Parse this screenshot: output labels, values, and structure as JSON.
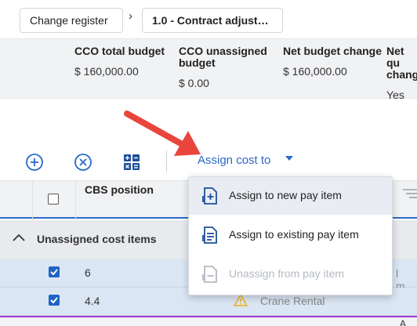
{
  "breadcrumb": {
    "parent": "Change register",
    "separator": "›",
    "current": "1.0 - Contract adjust…"
  },
  "summary": [
    {
      "label": "CCO total budget",
      "value": "$ 160,000.00"
    },
    {
      "label": "CCO unassigned budget",
      "value": "$ 0.00"
    },
    {
      "label": "Net budget change",
      "value": "$ 160,000.00"
    },
    {
      "label": "Net qu chang",
      "value": "Yes"
    }
  ],
  "toolbar": {
    "add_icon": "plus-circle-icon",
    "remove_icon": "x-circle-icon",
    "calc_icon": "calculator-icon",
    "assign_label": "Assign cost to"
  },
  "menu": {
    "items": [
      {
        "label": "Assign to new pay item",
        "icon": "add-pay-item-icon",
        "state": "highlighted"
      },
      {
        "label": "Assign to existing pay item",
        "icon": "existing-pay-item-icon",
        "state": "enabled"
      },
      {
        "label": "Unassign from pay item",
        "icon": "unassign-pay-item-icon",
        "state": "disabled"
      }
    ]
  },
  "table": {
    "header": {
      "cbs_position": "CBS position"
    },
    "group": {
      "label": "Unassigned cost items"
    },
    "rows": [
      {
        "checked": true,
        "cbs": "6",
        "description": "l m…"
      },
      {
        "checked": true,
        "cbs": "4.4",
        "description": "Crane Rental",
        "warning": true
      }
    ],
    "footer_truncated": "A"
  },
  "colors": {
    "accent": "#2b6ac8",
    "annotation_arrow": "#e8453c",
    "selected_row": "#dbe6f4",
    "checkbox": "#1f63c6",
    "warning": "#f2b01e"
  }
}
